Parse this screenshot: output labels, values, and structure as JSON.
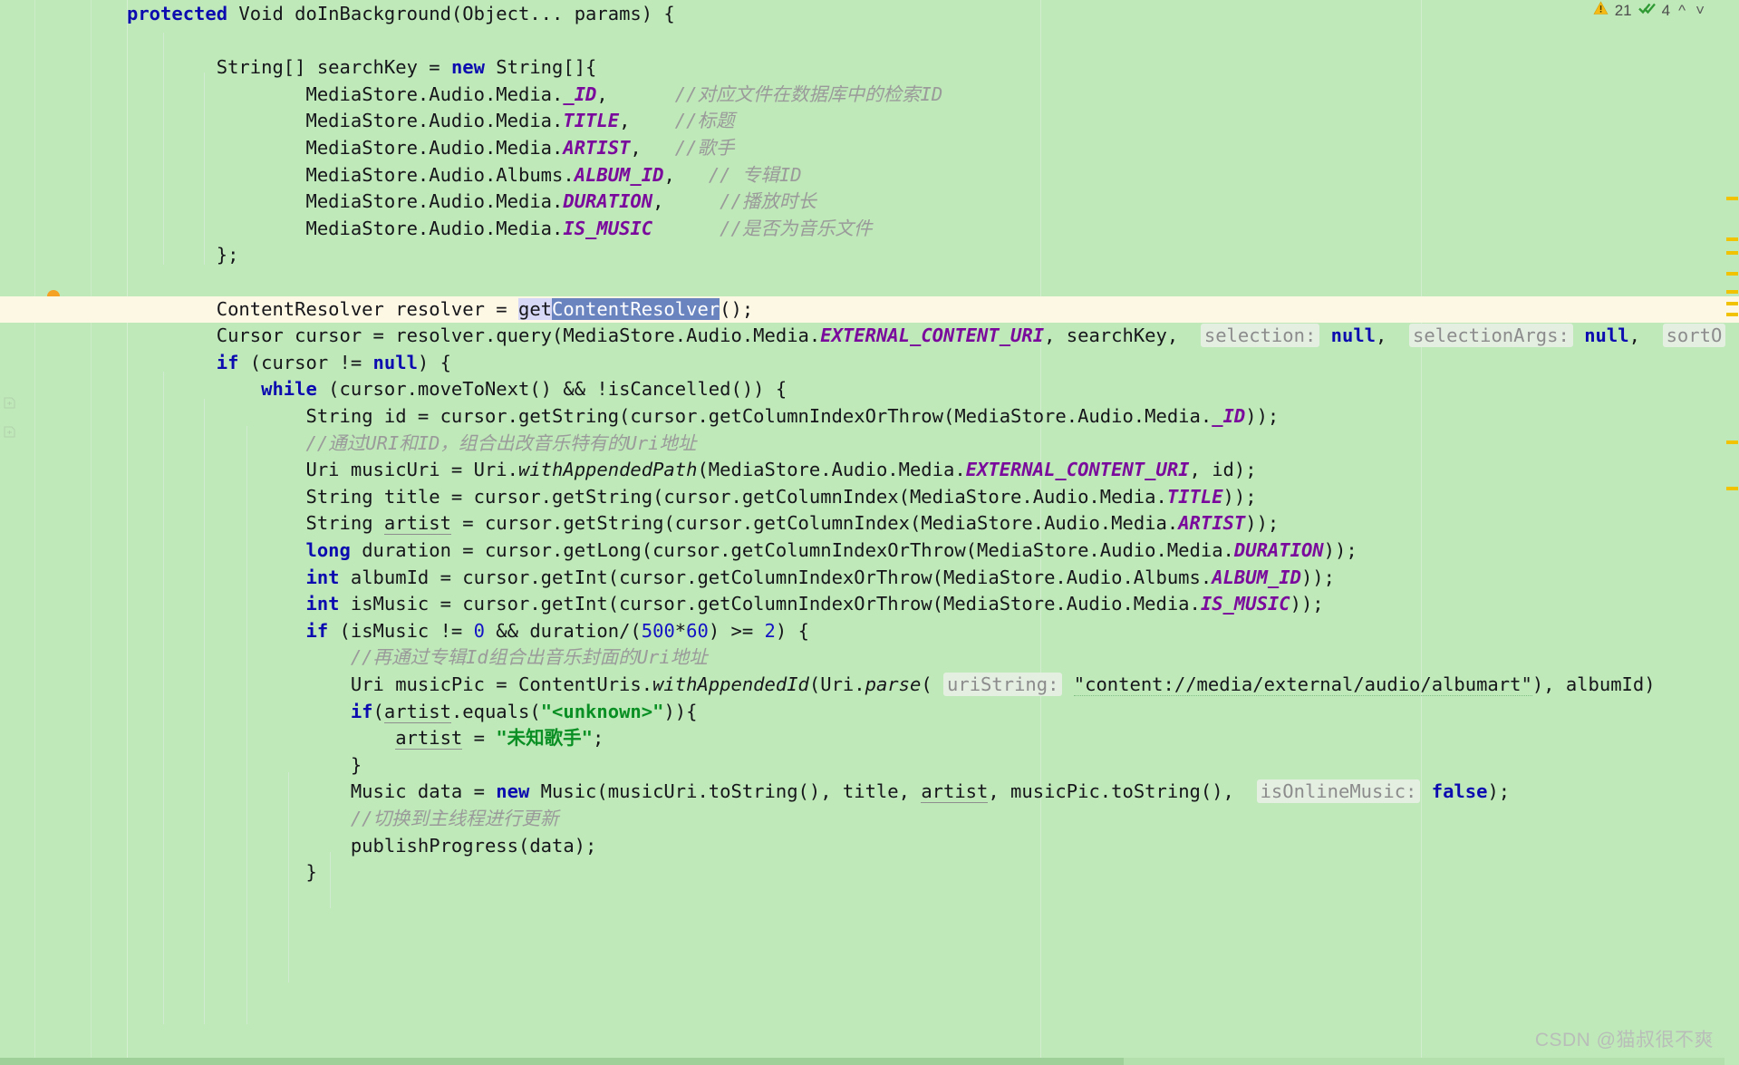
{
  "editor": {
    "language": "java",
    "background_color": "#bfe9b9",
    "caret_line_color": "#fdf8e4",
    "selection_color": "#6a84c0",
    "lines": [
      {
        "indent": 0,
        "segments": [
          {
            "t": "protected",
            "c": "kw"
          },
          {
            "t": " Void doInBackground(Object... params) {",
            "c": "plain"
          }
        ]
      },
      {
        "indent": 0,
        "segments": []
      },
      {
        "indent": 4,
        "segments": [
          {
            "t": "String[] searchKey = ",
            "c": "plain"
          },
          {
            "t": "new",
            "c": "kw"
          },
          {
            "t": " String[]{",
            "c": "plain"
          }
        ]
      },
      {
        "indent": 8,
        "segments": [
          {
            "t": "MediaStore.Audio.Media.",
            "c": "plain"
          },
          {
            "t": "_ID",
            "c": "const"
          },
          {
            "t": ",",
            "c": "plain"
          },
          {
            "t": "      ",
            "c": "plain"
          },
          {
            "t": "//对应文件在数据库中的检索ID",
            "c": "cmt"
          }
        ]
      },
      {
        "indent": 8,
        "segments": [
          {
            "t": "MediaStore.Audio.Media.",
            "c": "plain"
          },
          {
            "t": "TITLE",
            "c": "const"
          },
          {
            "t": ",",
            "c": "plain"
          },
          {
            "t": "    ",
            "c": "plain"
          },
          {
            "t": "//标题",
            "c": "cmt"
          }
        ]
      },
      {
        "indent": 8,
        "segments": [
          {
            "t": "MediaStore.Audio.Media.",
            "c": "plain"
          },
          {
            "t": "ARTIST",
            "c": "const"
          },
          {
            "t": ",",
            "c": "plain"
          },
          {
            "t": "   ",
            "c": "plain"
          },
          {
            "t": "//歌手",
            "c": "cmt"
          }
        ]
      },
      {
        "indent": 8,
        "segments": [
          {
            "t": "MediaStore.Audio.Albums.",
            "c": "plain"
          },
          {
            "t": "ALBUM_ID",
            "c": "const"
          },
          {
            "t": ",",
            "c": "plain"
          },
          {
            "t": "   ",
            "c": "plain"
          },
          {
            "t": "// 专辑ID",
            "c": "cmt"
          }
        ]
      },
      {
        "indent": 8,
        "segments": [
          {
            "t": "MediaStore.Audio.Media.",
            "c": "plain"
          },
          {
            "t": "DURATION",
            "c": "const"
          },
          {
            "t": ",",
            "c": "plain"
          },
          {
            "t": "     ",
            "c": "plain"
          },
          {
            "t": "//播放时长",
            "c": "cmt"
          }
        ]
      },
      {
        "indent": 8,
        "segments": [
          {
            "t": "MediaStore.Audio.Media.",
            "c": "plain"
          },
          {
            "t": "IS_MUSIC",
            "c": "const"
          },
          {
            "t": "      ",
            "c": "plain"
          },
          {
            "t": "//是否为音乐文件",
            "c": "cmt"
          }
        ]
      },
      {
        "indent": 4,
        "segments": [
          {
            "t": "};",
            "c": "plain"
          }
        ]
      },
      {
        "indent": 0,
        "segments": []
      }
    ],
    "caret_line": {
      "indent": 4,
      "prefix": "ContentResolver resolver = ",
      "soft_selection": "get",
      "selection": "ContentResolver",
      "suffix": "();"
    },
    "lines_after": [
      {
        "indent": 4,
        "segments": [
          {
            "t": "Cursor cursor = resolver.query(MediaStore.Audio.Media.",
            "c": "plain"
          },
          {
            "t": "EXTERNAL_CONTENT_URI",
            "c": "const"
          },
          {
            "t": ", searchKey,  ",
            "c": "plain"
          },
          {
            "t": "selection:",
            "c": "hint"
          },
          {
            "t": " ",
            "c": "plain"
          },
          {
            "t": "null",
            "c": "kw"
          },
          {
            "t": ",  ",
            "c": "plain"
          },
          {
            "t": "selectionArgs:",
            "c": "hint"
          },
          {
            "t": " ",
            "c": "plain"
          },
          {
            "t": "null",
            "c": "kw"
          },
          {
            "t": ",  ",
            "c": "plain"
          },
          {
            "t": "sortO",
            "c": "hint"
          }
        ]
      },
      {
        "indent": 4,
        "segments": [
          {
            "t": "if",
            "c": "kw"
          },
          {
            "t": " (cursor != ",
            "c": "plain"
          },
          {
            "t": "null",
            "c": "kw"
          },
          {
            "t": ") {",
            "c": "plain"
          }
        ]
      },
      {
        "indent": 6,
        "segments": [
          {
            "t": "while",
            "c": "kw"
          },
          {
            "t": " (cursor.moveToNext() && !isCancelled()) {",
            "c": "plain"
          }
        ]
      },
      {
        "indent": 8,
        "segments": [
          {
            "t": "String id = cursor.getString(cursor.getColumnIndexOrThrow(MediaStore.Audio.Media.",
            "c": "plain"
          },
          {
            "t": "_ID",
            "c": "const"
          },
          {
            "t": "));",
            "c": "plain"
          }
        ]
      },
      {
        "indent": 8,
        "segments": [
          {
            "t": "//通过URI和ID，组合出改音乐特有的Uri地址",
            "c": "cmt"
          }
        ]
      },
      {
        "indent": 8,
        "segments": [
          {
            "t": "Uri musicUri = Uri.",
            "c": "plain"
          },
          {
            "t": "withAppendedPath",
            "c": "ital"
          },
          {
            "t": "(MediaStore.Audio.Media.",
            "c": "plain"
          },
          {
            "t": "EXTERNAL_CONTENT_URI",
            "c": "const"
          },
          {
            "t": ", id);",
            "c": "plain"
          }
        ]
      },
      {
        "indent": 8,
        "segments": [
          {
            "t": "String title = cursor.getString(cursor.getColumnIndex(MediaStore.Audio.Media.",
            "c": "plain"
          },
          {
            "t": "TITLE",
            "c": "const"
          },
          {
            "t": "));",
            "c": "plain"
          }
        ]
      },
      {
        "indent": 8,
        "segments": [
          {
            "t": "String ",
            "c": "plain"
          },
          {
            "t": "artist",
            "c": "ident-uln"
          },
          {
            "t": " = cursor.getString(cursor.getColumnIndex(MediaStore.Audio.Media.",
            "c": "plain"
          },
          {
            "t": "ARTIST",
            "c": "const"
          },
          {
            "t": "));",
            "c": "plain"
          }
        ]
      },
      {
        "indent": 8,
        "segments": [
          {
            "t": "long",
            "c": "kw"
          },
          {
            "t": " duration = cursor.getLong(cursor.getColumnIndexOrThrow(MediaStore.Audio.Media.",
            "c": "plain"
          },
          {
            "t": "DURATION",
            "c": "const"
          },
          {
            "t": "));",
            "c": "plain"
          }
        ]
      },
      {
        "indent": 8,
        "segments": [
          {
            "t": "int",
            "c": "kw"
          },
          {
            "t": " albumId = cursor.getInt(cursor.getColumnIndexOrThrow(MediaStore.Audio.Albums.",
            "c": "plain"
          },
          {
            "t": "ALBUM_ID",
            "c": "const"
          },
          {
            "t": "));",
            "c": "plain"
          }
        ]
      },
      {
        "indent": 8,
        "segments": [
          {
            "t": "int",
            "c": "kw"
          },
          {
            "t": " isMusic = cursor.getInt(cursor.getColumnIndexOrThrow(MediaStore.Audio.Media.",
            "c": "plain"
          },
          {
            "t": "IS_MUSIC",
            "c": "const"
          },
          {
            "t": "));",
            "c": "plain"
          }
        ]
      },
      {
        "indent": 8,
        "segments": [
          {
            "t": "if",
            "c": "kw"
          },
          {
            "t": " (isMusic != ",
            "c": "plain"
          },
          {
            "t": "0",
            "c": "num"
          },
          {
            "t": " && duration/(",
            "c": "plain"
          },
          {
            "t": "500",
            "c": "num"
          },
          {
            "t": "*",
            "c": "plain"
          },
          {
            "t": "60",
            "c": "num"
          },
          {
            "t": ") >= ",
            "c": "plain"
          },
          {
            "t": "2",
            "c": "num"
          },
          {
            "t": ") {",
            "c": "plain"
          }
        ]
      },
      {
        "indent": 10,
        "segments": [
          {
            "t": "//再通过专辑Id组合出音乐封面的Uri地址",
            "c": "cmt"
          }
        ]
      },
      {
        "indent": 10,
        "segments": [
          {
            "t": "Uri musicPic = ContentUris.",
            "c": "plain"
          },
          {
            "t": "withAppendedId",
            "c": "ital"
          },
          {
            "t": "(Uri.",
            "c": "plain"
          },
          {
            "t": "parse",
            "c": "ital"
          },
          {
            "t": "( ",
            "c": "plain"
          },
          {
            "t": "uriString:",
            "c": "hint"
          },
          {
            "t": " ",
            "c": "plain"
          },
          {
            "t": "\"content://media/external/audio/albumart\"",
            "c": "str-uln"
          },
          {
            "t": "), albumId)",
            "c": "plain"
          }
        ]
      },
      {
        "indent": 10,
        "segments": [
          {
            "t": "if",
            "c": "kw"
          },
          {
            "t": "(",
            "c": "plain"
          },
          {
            "t": "artist",
            "c": "ident-uln"
          },
          {
            "t": ".equals(",
            "c": "plain"
          },
          {
            "t": "\"<unknown>\"",
            "c": "str"
          },
          {
            "t": ")){",
            "c": "plain"
          }
        ]
      },
      {
        "indent": 12,
        "segments": [
          {
            "t": "artist",
            "c": "ident-uln"
          },
          {
            "t": " = ",
            "c": "plain"
          },
          {
            "t": "\"未知歌手\"",
            "c": "str"
          },
          {
            "t": ";",
            "c": "plain"
          }
        ]
      },
      {
        "indent": 10,
        "segments": [
          {
            "t": "}",
            "c": "plain"
          }
        ]
      },
      {
        "indent": 10,
        "segments": [
          {
            "t": "Music data = ",
            "c": "plain"
          },
          {
            "t": "new",
            "c": "kw"
          },
          {
            "t": " Music(musicUri.toString(), title, ",
            "c": "plain"
          },
          {
            "t": "artist",
            "c": "ident-uln"
          },
          {
            "t": ", musicPic.toString(),  ",
            "c": "plain"
          },
          {
            "t": "isOnlineMusic:",
            "c": "hint"
          },
          {
            "t": " ",
            "c": "plain"
          },
          {
            "t": "false",
            "c": "kw"
          },
          {
            "t": ");",
            "c": "plain"
          }
        ]
      },
      {
        "indent": 10,
        "segments": [
          {
            "t": "//切换到主线程进行更新",
            "c": "cmt"
          }
        ]
      },
      {
        "indent": 10,
        "segments": [
          {
            "t": "publishProgress(data);",
            "c": "plain"
          }
        ]
      },
      {
        "indent": 8,
        "segments": [
          {
            "t": "}",
            "c": "plain"
          }
        ]
      }
    ]
  },
  "inspection_widget": {
    "warning_icon": "warning-triangle-icon",
    "warning_count": "21",
    "ok_icon": "double-check-icon",
    "ok_count": "4",
    "prev_icon": "chevron-up-icon",
    "next_icon": "chevron-down-icon",
    "warning_color": "#f5ba14",
    "ok_color": "#2f9a34"
  },
  "gutter": {
    "intention_bulb_icon": "lightbulb-icon",
    "fold_icons": [
      "fold-arrow-icon",
      "fold-arrow-icon"
    ]
  },
  "error_stripe": {
    "mark_color": "#f0c200",
    "marks_y": [
      217,
      262,
      277,
      300,
      320,
      333,
      345,
      486,
      537
    ]
  },
  "watermark": {
    "text": "CSDN @猫叔很不爽"
  }
}
